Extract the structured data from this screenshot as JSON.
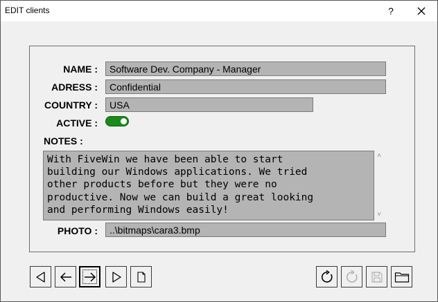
{
  "window": {
    "title": "EDIT clients",
    "help_label": "?",
    "close_icon": "close-icon"
  },
  "form": {
    "name": {
      "label": "NAME :",
      "value": "Software Dev. Company - Manager"
    },
    "adress": {
      "label": "ADRESS :",
      "value": "Confidential"
    },
    "country": {
      "label": "COUNTRY :",
      "value": "USA"
    },
    "active": {
      "label": "ACTIVE :",
      "on": true,
      "color": "#1a8a1a"
    },
    "notes": {
      "label": "NOTES :",
      "value": "With FiveWin we have been able to start\nbuilding our Windows applications. We tried\nother products before but they were no\nproductive. Now we can build a great looking\nand performing Windows easily!"
    },
    "photo": {
      "label": "PHOTO :",
      "value": "..\\bitmaps\\cara3.bmp"
    }
  },
  "toolbar": {
    "left": [
      {
        "name": "first-record-button",
        "icon": "triangle-left-icon"
      },
      {
        "name": "previous-record-button",
        "icon": "arrow-left-icon"
      },
      {
        "name": "next-record-button",
        "icon": "arrow-right-icon",
        "focused": true
      },
      {
        "name": "last-record-button",
        "icon": "triangle-right-icon"
      },
      {
        "name": "new-record-button",
        "icon": "document-icon"
      }
    ],
    "right": [
      {
        "name": "refresh-button",
        "icon": "refresh-icon",
        "enabled": true
      },
      {
        "name": "undo-button",
        "icon": "undo-icon",
        "enabled": false
      },
      {
        "name": "save-button",
        "icon": "floppy-disk-icon",
        "enabled": false
      },
      {
        "name": "open-folder-button",
        "icon": "folder-icon",
        "enabled": true
      }
    ]
  }
}
